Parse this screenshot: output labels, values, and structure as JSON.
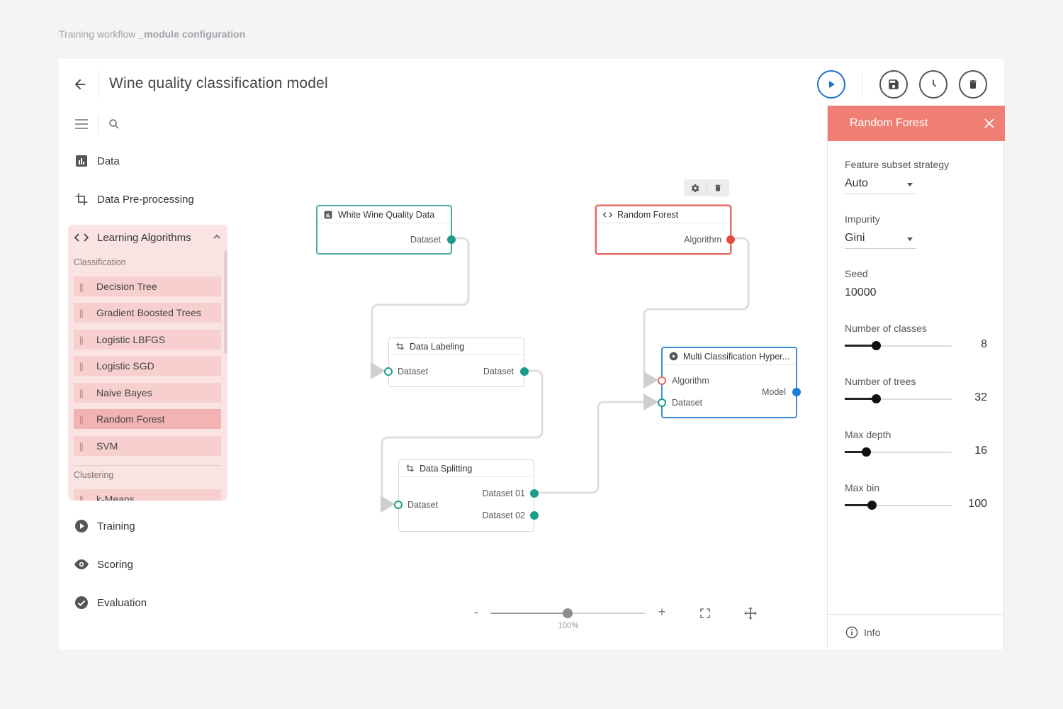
{
  "caption": {
    "prefix": "Training workflow",
    "bold": "_module configuration"
  },
  "header": {
    "title": "Wine quality classification model"
  },
  "sidebar": {
    "nav_top": [
      {
        "label": "Data",
        "icon": "bar-chart-icon"
      },
      {
        "label": "Data Pre-processing",
        "icon": "crop-icon"
      }
    ],
    "algorithms": {
      "label": "Learning Algorithms",
      "groups": [
        {
          "label": "Classification",
          "items": [
            "Decision Tree",
            "Gradient Boosted Trees",
            "Logistic LBFGS",
            "Logistic SGD",
            "Naive Bayes",
            "Random Forest",
            "SVM"
          ],
          "selected": "Random Forest"
        },
        {
          "label": "Clustering",
          "items": [
            "k-Means"
          ]
        }
      ]
    },
    "nav_bottom": [
      {
        "label": "Training",
        "icon": "play-circle-icon"
      },
      {
        "label": "Scoring",
        "icon": "eye-icon"
      },
      {
        "label": "Evaluation",
        "icon": "check-circle-icon"
      }
    ]
  },
  "canvas": {
    "nodes": {
      "white_wine": {
        "title": "White Wine Quality Data",
        "out": "Dataset"
      },
      "random_forest": {
        "title": "Random Forest",
        "out": "Algorithm"
      },
      "labeling": {
        "title": "Data Labeling",
        "in": "Dataset",
        "out": "Dataset"
      },
      "splitting": {
        "title": "Data Splitting",
        "in": "Dataset",
        "out1": "Dataset 01",
        "out2": "Dataset 02"
      },
      "multi": {
        "title": "Multi Classification Hyper...",
        "in1": "Algorithm",
        "in2": "Dataset",
        "out": "Model"
      }
    },
    "zoom": {
      "minus": "-",
      "plus": "+",
      "value": 0.5,
      "label": "100%"
    }
  },
  "panel": {
    "title": "Random Forest",
    "feature_subset": {
      "label": "Feature subset strategy",
      "value": "Auto"
    },
    "impurity": {
      "label": "Impurity",
      "value": "Gini"
    },
    "seed": {
      "label": "Seed",
      "value": "10000"
    },
    "sliders": [
      {
        "label": "Number of classes",
        "value": "8",
        "fraction": 0.29
      },
      {
        "label": "Number of trees",
        "value": "32",
        "fraction": 0.29
      },
      {
        "label": "Max depth",
        "value": "16",
        "fraction": 0.2
      },
      {
        "label": "Max bin",
        "value": "100",
        "fraction": 0.25
      }
    ],
    "footer": "Info"
  },
  "colors": {
    "accent_blue": "#1a73c8",
    "panel_head": "#ef7f75",
    "teal": "#1b9b8a",
    "red": "#e34b43"
  }
}
